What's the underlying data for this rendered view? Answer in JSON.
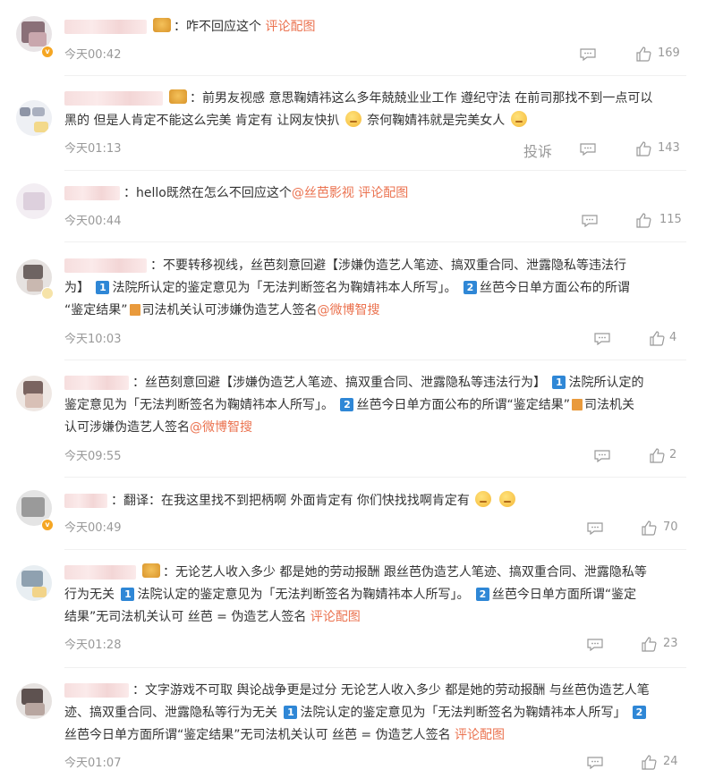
{
  "comments": [
    {
      "text": "咋不回应这个",
      "link": "评论配图",
      "time": "今天00:42",
      "likes": "169"
    },
    {
      "line1": "前男友视感 意思鞠婧祎这么多年兢兢业业工作 遵纪守法 在前司那找不到一点可以",
      "line2a": "黑的 但是人肯定不能这么完美 肯定有 让网友快扒",
      "line2b": "奈何鞠婧祎就是完美女人",
      "report": "投诉",
      "time": "今天01:13",
      "likes": "143"
    },
    {
      "text": "hello既然在怎么不回应这个",
      "mention": "@丝芭影视",
      "link": "评论配图",
      "time": "今天00:44",
      "likes": "115"
    },
    {
      "line1": "不要转移视线，丝芭刻意回避【涉嫌伪造艺人笔迹、搞双重合同、泄露隐私等违法行",
      "line2a": "为】",
      "n1": "1",
      "line2b": "法院所认定的鉴定意见为「无法判断签名为鞠婧祎本人所写」。",
      "n2": "2",
      "line2c": "丝芭今日单方面公布的所谓",
      "line3a": "“鉴定结果”",
      "line3b": "司法机关认可涉嫌伪造艺人签名",
      "mention": "@微博智搜",
      "time": "今天10:03",
      "likes": "4"
    },
    {
      "line1a": "丝芭刻意回避【涉嫌伪造艺人笔迹、搞双重合同、泄露隐私等违法行为】",
      "n1": "1",
      "line1b": "法院所认定的",
      "line2a": "鉴定意见为「无法判断签名为鞠婧祎本人所写」。",
      "n2": "2",
      "line2b": "丝芭今日单方面公布的所谓“鉴定结果”",
      "line2c": "司法机关",
      "line3a": "认可涉嫌伪造艺人签名",
      "mention": "@微博智搜",
      "time": "今天09:55",
      "likes": "2"
    },
    {
      "text": "翻译：在我这里找不到把柄啊 外面肯定有 你们快找找啊肯定有",
      "time": "今天00:49",
      "likes": "70"
    },
    {
      "line1": "无论艺人收入多少 都是她的劳动报酬 跟丝芭伪造艺人笔迹、搞双重合同、泄露隐私等",
      "line2a": "行为无关",
      "n1": "1",
      "line2b": "法院认定的鉴定意见为「无法判断签名为鞠婧祎本人所写」。",
      "n2": "2",
      "line2c": "丝芭今日单方面所谓“鉴定",
      "line3a": "结果”无司法机关认可 丝芭 = 伪造艺人签名",
      "link": "评论配图",
      "time": "今天01:28",
      "likes": "23"
    },
    {
      "line1": "文字游戏不可取 舆论战争更是过分 无论艺人收入多少 都是她的劳动报酬 与丝芭伪造艺人笔",
      "line2a": "迹、搞双重合同、泄露隐私等行为无关",
      "n1": "1",
      "line2b": "法院认定的鉴定意见为「无法判断签名为鞠婧祎本人所写」",
      "n2": "2",
      "line3a": "丝芭今日单方面所谓“鉴定结果”无司法机关认可 丝芭 = 伪造艺人签名",
      "link": "评论配图",
      "time": "今天01:07",
      "likes": "24"
    }
  ],
  "colors": {
    "link": "#eb7350",
    "text": "#333333",
    "meta": "#999999",
    "badge": "#2f87d6"
  }
}
